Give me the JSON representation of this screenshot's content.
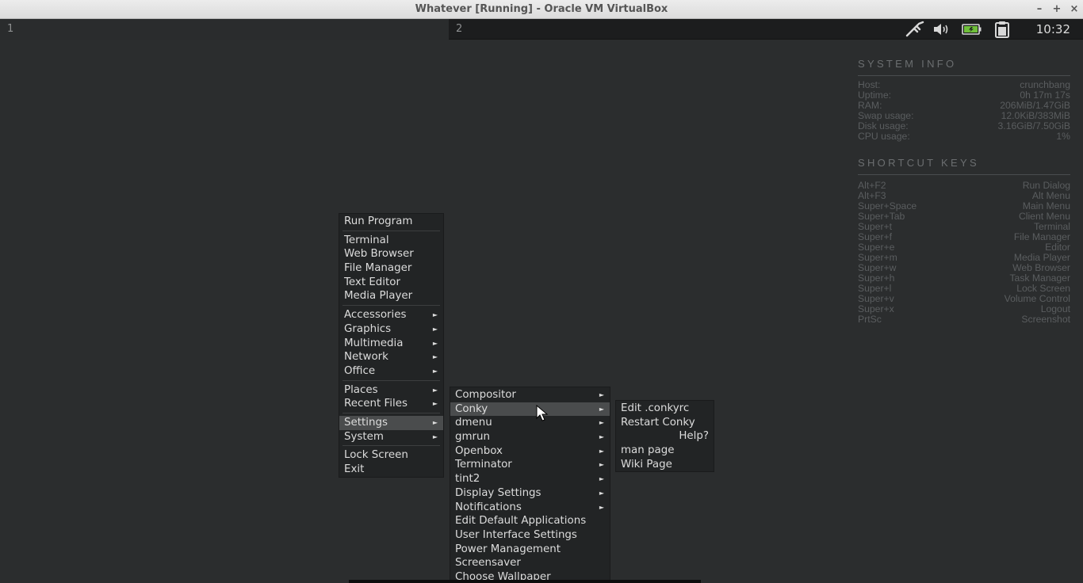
{
  "window": {
    "title": "Whatever [Running] - Oracle VM VirtualBox",
    "controls": {
      "minimize": "–",
      "maximize": "+",
      "close": "×"
    }
  },
  "panel": {
    "desktops": [
      "1",
      "2"
    ],
    "tray_icons": [
      "network-icon",
      "volume-icon",
      "battery-icon",
      "clipboard-icon"
    ],
    "clock": "10:32"
  },
  "conky": {
    "system_info": {
      "heading": "SYSTEM INFO",
      "rows": [
        {
          "label": "Host:",
          "value": "crunchbang"
        },
        {
          "label": "Uptime:",
          "value": "0h 17m 17s"
        },
        {
          "label": "RAM:",
          "value": "206MiB/1.47GiB"
        },
        {
          "label": "Swap usage:",
          "value": "12.0KiB/383MiB"
        },
        {
          "label": "Disk usage:",
          "value": "3.16GiB/7.50GiB"
        },
        {
          "label": "CPU usage:",
          "value": "1%"
        }
      ]
    },
    "shortcut_keys": {
      "heading": "SHORTCUT KEYS",
      "rows": [
        {
          "key": "Alt+F2",
          "action": "Run Dialog"
        },
        {
          "key": "Alt+F3",
          "action": "Alt Menu"
        },
        {
          "key": "Super+Space",
          "action": "Main Menu"
        },
        {
          "key": "Super+Tab",
          "action": "Client Menu"
        },
        {
          "key": "Super+t",
          "action": "Terminal"
        },
        {
          "key": "Super+f",
          "action": "File Manager"
        },
        {
          "key": "Super+e",
          "action": "Editor"
        },
        {
          "key": "Super+m",
          "action": "Media Player"
        },
        {
          "key": "Super+w",
          "action": "Web Browser"
        },
        {
          "key": "Super+h",
          "action": "Task Manager"
        },
        {
          "key": "Super+l",
          "action": "Lock Screen"
        },
        {
          "key": "Super+v",
          "action": "Volume Control"
        },
        {
          "key": "Super+x",
          "action": "Logout"
        },
        {
          "key": "PrtSc",
          "action": "Screenshot"
        }
      ]
    }
  },
  "main_menu": {
    "items": [
      "Run Program",
      "Terminal",
      "Web Browser",
      "File Manager",
      "Text Editor",
      "Media Player",
      "Accessories",
      "Graphics",
      "Multimedia",
      "Network",
      "Office",
      "Places",
      "Recent Files",
      "Settings",
      "System",
      "Lock Screen",
      "Exit"
    ],
    "active_item": "Settings"
  },
  "settings_menu": {
    "items": [
      "Compositor",
      "Conky",
      "dmenu",
      "gmrun",
      "Openbox",
      "Terminator",
      "tint2",
      "Display Settings",
      "Notifications",
      "Edit Default Applications",
      "User Interface Settings",
      "Power Management",
      "Screensaver",
      "Choose Wallpaper"
    ],
    "active_item": "Conky"
  },
  "conky_menu": {
    "items": [
      "Edit .conkyrc",
      "Restart Conky",
      "Help?",
      "man page",
      "Wiki Page"
    ]
  },
  "submenu_arrow": "►",
  "colors": {
    "desktop_bg": "#2b2d2e",
    "menu_bg": "#222425",
    "menu_highlight": "#4a4c4d",
    "conky_text": "#5a5d5f"
  }
}
